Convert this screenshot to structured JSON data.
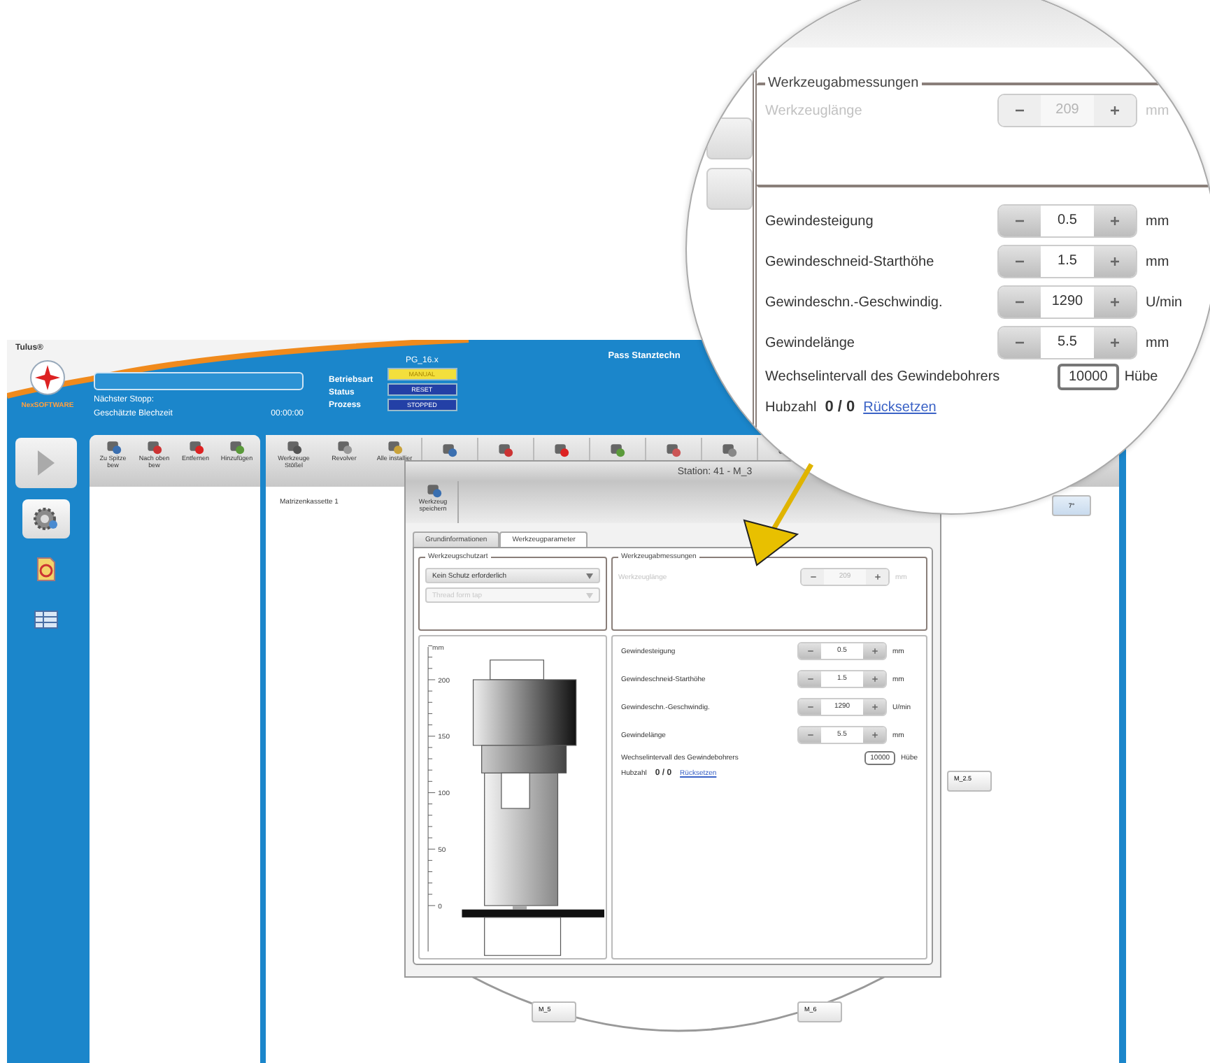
{
  "app_title": "Tulus®",
  "logo_caption": "NexSOFTWARE",
  "company": "Pass Stanztechn",
  "header": {
    "next_stop_label": "Nächster Stopp:",
    "sheet_time_label": "Geschätzte Blechzeit",
    "sheet_time": "00:00:00",
    "program": "PG_16.x",
    "status_rows": [
      {
        "label": "Betriebsart",
        "value": "MANUAL",
        "color": "#f3df3c"
      },
      {
        "label": "Status",
        "value": "RESET",
        "color": "#2340a6"
      },
      {
        "label": "Prozess",
        "value": "STOPPED",
        "color": "#2340a6"
      }
    ]
  },
  "sidebar_items": [
    {
      "kind": "gear",
      "selected": true
    },
    {
      "kind": "document",
      "selected": false
    },
    {
      "kind": "table",
      "selected": false
    }
  ],
  "list_toolbar": [
    "Zu Spitze bew",
    "Nach oben bew",
    "Entfernen",
    "Hinzufügen"
  ],
  "main_toolbar": [
    "Werkzeuge Stößel",
    "Revolver",
    "Alle installier"
  ],
  "cassette_label": "Matrizenkassette 1",
  "angle_button": "7°",
  "station_buttons": [
    {
      "label": "M_2.5"
    },
    {
      "label": "M_5"
    },
    {
      "label": "M_6"
    }
  ],
  "dialog": {
    "title": "Station: 41 - M_3",
    "toolbar": [
      "Werkzeug speichern"
    ],
    "tabs": [
      {
        "label": "Grundinformationen",
        "selected": false
      },
      {
        "label": "Werkzeugparameter",
        "selected": true
      }
    ],
    "protection": {
      "legend": "Werkzeugschutzart",
      "dropdowns": [
        {
          "value": "Kein Schutz erforderlich",
          "disabled": false
        },
        {
          "value": "Thread form tap",
          "disabled": true
        }
      ]
    },
    "dimensions": {
      "legend": "Werkzeugabmessungen",
      "fields": [
        {
          "label": "Werkzeuglänge",
          "value": "209",
          "unit": "mm",
          "disabled": true
        }
      ]
    },
    "ruler": {
      "unit": "mm",
      "ticks": [
        "200",
        "150",
        "100",
        "50",
        "0"
      ]
    },
    "parameters": [
      {
        "label": "Gewindesteigung",
        "value": "0.5",
        "unit": "mm",
        "disabled": false
      },
      {
        "label": "Gewindeschneid-Starthöhe",
        "value": "1.5",
        "unit": "mm",
        "disabled": false
      },
      {
        "label": "Gewindeschn.-Geschwindig.",
        "value": "1290",
        "unit": "U/min",
        "disabled": false
      },
      {
        "label": "Gewindelänge",
        "value": "5.5",
        "unit": "mm",
        "disabled": false
      }
    ],
    "interval": {
      "label": "Wechselintervall des Gewindebohrers",
      "value": "10000",
      "unit": "Hübe"
    },
    "stroke_count": {
      "label": "Hubzahl",
      "value": "0 / 0",
      "link": "Rücksetzen"
    }
  },
  "magnifier": {
    "dimensions": {
      "legend": "Werkzeugabmessungen",
      "fields": [
        {
          "label": "Werkzeuglänge",
          "value": "209",
          "unit": "mm",
          "disabled": true
        }
      ]
    },
    "parameters": [
      {
        "label": "Gewindesteigung",
        "value": "0.5",
        "unit": "mm",
        "disabled": false
      },
      {
        "label": "Gewindeschneid-Starthöhe",
        "value": "1.5",
        "unit": "mm",
        "disabled": false
      },
      {
        "label": "Gewindeschn.-Geschwindig.",
        "value": "1290",
        "unit": "U/min",
        "disabled": false
      },
      {
        "label": "Gewindelänge",
        "value": "5.5",
        "unit": "mm",
        "disabled": false
      }
    ],
    "interval": {
      "label": "Wechselintervall des Gewindebohrers",
      "value": "10000",
      "unit": "Hübe"
    },
    "stroke_count": {
      "label": "Hubzahl",
      "value": "0 / 0",
      "link": "Rücksetzen"
    }
  }
}
